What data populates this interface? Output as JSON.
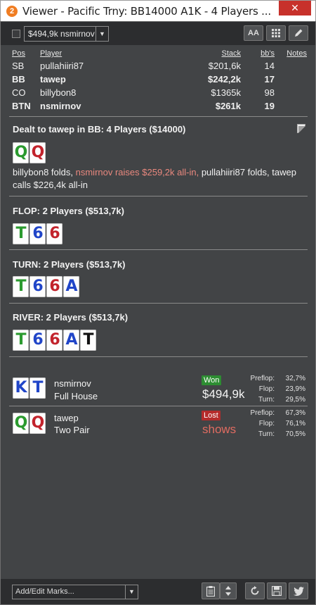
{
  "window": {
    "icon_text": "2",
    "title": "Viewer - Pacific Trny: BB14000 A1K - 4 Players ...",
    "close_glyph": "✕"
  },
  "toolbar": {
    "hand_select_value": "$494,9k nsmirnov",
    "dropdown_glyph": "▼",
    "font_button_label": "AA",
    "icons": [
      "font-size-icon",
      "grid-icon",
      "edit-pencil-icon"
    ]
  },
  "players": {
    "headers": {
      "pos": "Pos",
      "player": "Player",
      "stack": "Stack",
      "bbs": "bb's",
      "notes": "Notes"
    },
    "rows": [
      {
        "pos": "SB",
        "player": "pullahiiri87",
        "stack": "$201,6k",
        "bbs": "14",
        "bold": false
      },
      {
        "pos": "BB",
        "player": "tawep",
        "stack": "$242,2k",
        "bbs": "17",
        "bold": true
      },
      {
        "pos": "CO",
        "player": "billybon8",
        "stack": "$1365k",
        "bbs": "98",
        "bold": false
      },
      {
        "pos": "BTN",
        "player": "nsmirnov",
        "stack": "$261k",
        "bbs": "19",
        "bold": true
      }
    ]
  },
  "preflop": {
    "title": "Dealt to tawep in BB: 4 Players ($14000)",
    "hole_cards": [
      {
        "rank": "Q",
        "suit": "clubs"
      },
      {
        "rank": "Q",
        "suit": "hearts"
      }
    ],
    "action_part1": "billybon8 folds, ",
    "action_highlight": "nsmirnov raises $259,2k all-in,",
    "action_part2": " pullahiiri87 folds, tawep calls $226,4k all-in"
  },
  "flop": {
    "title": "FLOP: 2 Players ($513,7k)",
    "cards": [
      {
        "rank": "T",
        "suit": "clubs"
      },
      {
        "rank": "6",
        "suit": "diamonds"
      },
      {
        "rank": "6",
        "suit": "hearts"
      }
    ]
  },
  "turn": {
    "title": "TURN: 2 Players ($513,7k)",
    "cards": [
      {
        "rank": "T",
        "suit": "clubs"
      },
      {
        "rank": "6",
        "suit": "diamonds"
      },
      {
        "rank": "6",
        "suit": "hearts"
      },
      {
        "rank": "A",
        "suit": "diamonds"
      }
    ]
  },
  "river": {
    "title": "RIVER: 2 Players ($513,7k)",
    "cards": [
      {
        "rank": "T",
        "suit": "clubs"
      },
      {
        "rank": "6",
        "suit": "diamonds"
      },
      {
        "rank": "6",
        "suit": "hearts"
      },
      {
        "rank": "A",
        "suit": "diamonds"
      },
      {
        "rank": "T",
        "suit": "spades"
      }
    ]
  },
  "results": [
    {
      "player": "nsmirnov",
      "hand": "Full House",
      "cards": [
        {
          "rank": "K",
          "suit": "diamonds"
        },
        {
          "rank": "T",
          "suit": "diamonds"
        }
      ],
      "badge": "Won",
      "outcome": "won",
      "amount": "$494,9k",
      "equity": [
        {
          "label": "Preflop:",
          "value": "32,7%"
        },
        {
          "label": "Flop:",
          "value": "23,9%"
        },
        {
          "label": "Turn:",
          "value": "29,5%"
        }
      ]
    },
    {
      "player": "tawep",
      "hand": "Two Pair",
      "cards": [
        {
          "rank": "Q",
          "suit": "clubs"
        },
        {
          "rank": "Q",
          "suit": "hearts"
        }
      ],
      "badge": "Lost",
      "outcome": "lost",
      "amount": "shows",
      "equity": [
        {
          "label": "Preflop:",
          "value": "67,3%"
        },
        {
          "label": "Flop:",
          "value": "76,1%"
        },
        {
          "label": "Turn:",
          "value": "70,5%"
        }
      ]
    }
  ],
  "bottombar": {
    "marks_placeholder": "Add/Edit Marks...",
    "dropdown_glyph": "▼",
    "icons": [
      "clipboard-icon",
      "up-down-arrows-icon",
      "refresh-icon",
      "save-disk-icon",
      "twitter-icon"
    ]
  },
  "colors": {
    "clubs": "#2b9a2f",
    "hearts": "#c2232c",
    "diamonds": "#2045c8",
    "spades": "#111111",
    "won_badge": "#2d8d32",
    "lost_badge": "#b52b2b",
    "raise_highlight": "#e9887e",
    "panel_bg": "#424446"
  }
}
